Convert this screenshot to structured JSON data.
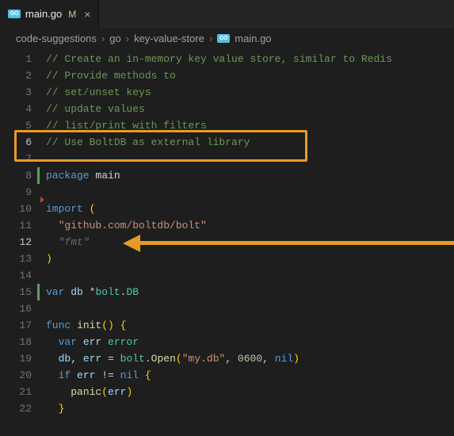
{
  "tab": {
    "filename": "main.go",
    "modified_badge": "M",
    "close_glyph": "×"
  },
  "breadcrumbs": {
    "seg1": "code-suggestions",
    "seg2": "go",
    "seg3": "key-value-store",
    "seg4": "main.go",
    "chevron": "›"
  },
  "gutter": {
    "l1": "1",
    "l2": "2",
    "l3": "3",
    "l4": "4",
    "l5": "5",
    "l6": "6",
    "l7": "7",
    "l8": "8",
    "l9": "9",
    "l10": "10",
    "l11": "11",
    "l12": "12",
    "l13": "13",
    "l14": "14",
    "l15": "15",
    "l16": "16",
    "l17": "17",
    "l18": "18",
    "l19": "19",
    "l20": "20",
    "l21": "21",
    "l22": "22"
  },
  "code": {
    "c1": "// Create an in-memory key value store, similar to Redis",
    "c2": "// Provide methods to",
    "c3": "// set/unset keys",
    "c4": "// update values",
    "c5": "// list/print with filters",
    "c6": "// Use BoltDB as external library",
    "kw_package": "package",
    "pkg_name": " main",
    "kw_import": "import",
    "l_open": " (",
    "imp1_q": "\"github.com/boltdb/bolt\"",
    "imp_ghost": "\"fmt\"",
    "r_close": ")",
    "kw_var": "var",
    "db_name": " db ",
    "star": "*",
    "bolt_type": "bolt",
    "dot": ".",
    "db_type": "DB",
    "kw_func": "func",
    "fn_init": " init",
    "paren_pair": "()",
    "brace_open": " {",
    "l18_kw": "var",
    "l18_var": " err ",
    "l18_type": "error",
    "l19_lhs": "db",
    "l19_comma1": ", ",
    "l19_err": "err",
    "l19_eq": " = ",
    "l19_bolt": "bolt",
    "l19_open": "Open",
    "l19_lp": "(",
    "l19_str": "\"my.db\"",
    "l19_c2": ", ",
    "l19_num": "0600",
    "l19_c3": ", ",
    "l19_nil": "nil",
    "l19_rp": ")",
    "l20_if": "if",
    "l20_cond": " err ",
    "l20_op": "!=",
    "l20_nil": " nil ",
    "l20_brace": "{",
    "l21_panic": "panic",
    "l21_lp": "(",
    "l21_err": "err",
    "l21_rp": ")",
    "l22_brace": "}"
  },
  "colors": {
    "annotation": "#e69b28",
    "editor_bg": "#1e1e1e"
  }
}
